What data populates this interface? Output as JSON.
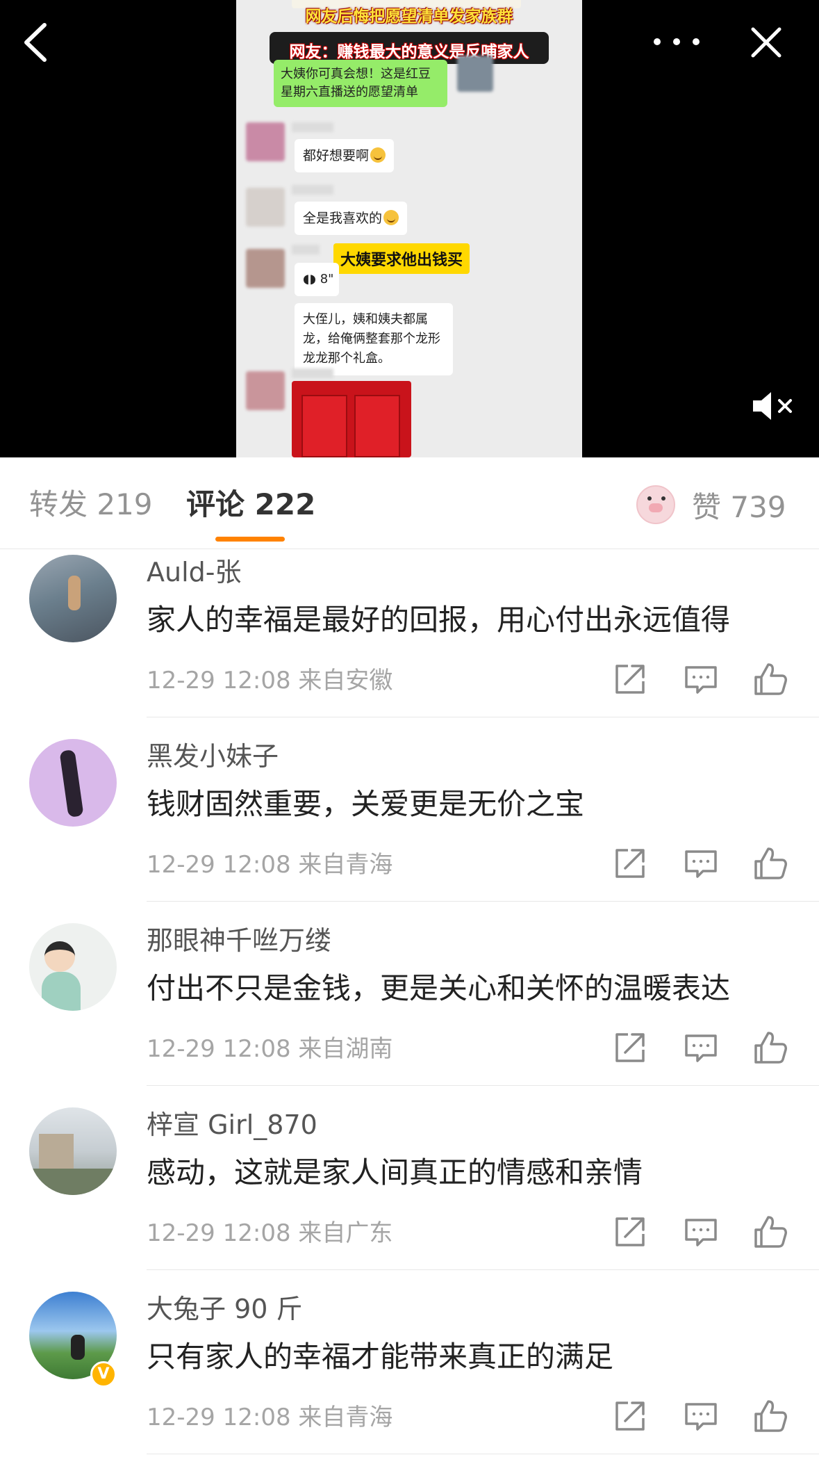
{
  "video": {
    "banner_top": "网友后悔把愿望清单发家族群",
    "banner_caption": "网友：赚钱最大的意义是反哺家人",
    "chat": {
      "msg_green": "大姨你可真会想！这是红豆星期六直播送的愿望清单",
      "msg_1": "都好想要啊",
      "msg_2": "全是我喜欢的",
      "voice_len": "8\"",
      "highlight": "大姨要求他出钱买",
      "msg_3": "大侄儿，姨和姨夫都属龙，给俺俩整套那个龙形龙龙那个礼盒。"
    },
    "icons": {
      "back": "back-arrow-icon",
      "more": "more-dots-icon",
      "close": "close-x-icon",
      "mute": "mute-speaker-icon"
    }
  },
  "tabs": {
    "repost": "转发 219",
    "comment": "评论 222",
    "like": "赞 739",
    "accent_color": "#ff8200"
  },
  "comments": [
    {
      "name": "Auld-张",
      "text": "家人的幸福是最好的回报，用心付出永远值得",
      "meta": "12-29 12:08  来自安徽",
      "verified": false
    },
    {
      "name": "黑发小妹子",
      "text": "钱财固然重要，关爱更是无价之宝",
      "meta": "12-29 12:08  来自青海",
      "verified": false
    },
    {
      "name": "那眼神千咝万缕",
      "text": "付出不只是金钱，更是关心和关怀的温暖表达",
      "meta": "12-29 12:08  来自湖南",
      "verified": false
    },
    {
      "name": "梓宣 Girl_870",
      "text": "感动，这就是家人间真正的情感和亲情",
      "meta": "12-29 12:08  来自广东",
      "verified": false
    },
    {
      "name": "大兔子 90 斤",
      "text": "只有家人的幸福才能带来真正的满足",
      "meta": "12-29 12:08  来自青海",
      "verified": true
    }
  ]
}
